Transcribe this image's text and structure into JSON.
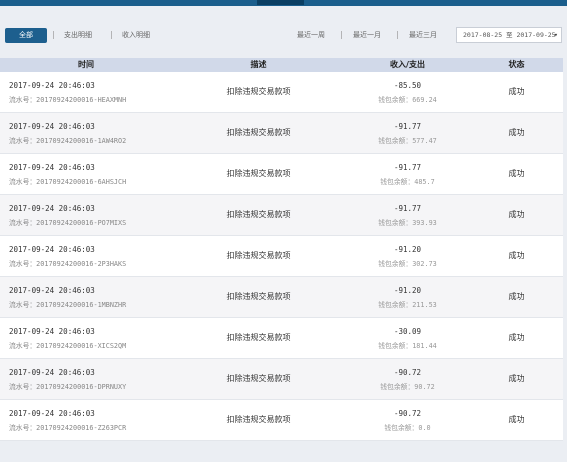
{
  "filters": {
    "all": "全部",
    "expense": "支出明细",
    "income": "收入明细",
    "separator": "|",
    "last_week": "最近一周",
    "last_month": "最近一月",
    "last_three_months": "最近三月",
    "date_range": "2017-08-25 至 2017-09-25"
  },
  "table": {
    "headers": {
      "time": "时间",
      "desc": "描述",
      "amount": "收入/支出",
      "status": "状态"
    },
    "rows": [
      {
        "time": "2017-09-24 20:46:03",
        "serial": "流水号：20170924200016-HEAXMNH",
        "desc": "扣除违规交易款项",
        "amount": "-85.50",
        "balance": "钱包余额：669.24",
        "status": "成功"
      },
      {
        "time": "2017-09-24 20:46:03",
        "serial": "流水号：20170924200016-1AW4RO2",
        "desc": "扣除违规交易款项",
        "amount": "-91.77",
        "balance": "钱包余额：577.47",
        "status": "成功"
      },
      {
        "time": "2017-09-24 20:46:03",
        "serial": "流水号：20170924200016-6AHSJCH",
        "desc": "扣除违规交易款项",
        "amount": "-91.77",
        "balance": "钱包余额：485.7",
        "status": "成功"
      },
      {
        "time": "2017-09-24 20:46:03",
        "serial": "流水号：20170924200016-PO7MIXS",
        "desc": "扣除违规交易款项",
        "amount": "-91.77",
        "balance": "钱包余额：393.93",
        "status": "成功"
      },
      {
        "time": "2017-09-24 20:46:03",
        "serial": "流水号：20170924200016-2P3HAKS",
        "desc": "扣除违规交易款项",
        "amount": "-91.20",
        "balance": "钱包余额：302.73",
        "status": "成功"
      },
      {
        "time": "2017-09-24 20:46:03",
        "serial": "流水号：20170924200016-1MBNZHR",
        "desc": "扣除违规交易款项",
        "amount": "-91.20",
        "balance": "钱包余额：211.53",
        "status": "成功"
      },
      {
        "time": "2017-09-24 20:46:03",
        "serial": "流水号：20170924200016-XICS2QM",
        "desc": "扣除违规交易款项",
        "amount": "-30.09",
        "balance": "钱包余额：181.44",
        "status": "成功"
      },
      {
        "time": "2017-09-24 20:46:03",
        "serial": "流水号：20170924200016-DPRNUXY",
        "desc": "扣除违规交易款项",
        "amount": "-90.72",
        "balance": "钱包余额：90.72",
        "status": "成功"
      },
      {
        "time": "2017-09-24 20:46:03",
        "serial": "流水号：20170924200016-Z263PCR",
        "desc": "扣除违规交易款项",
        "amount": "-90.72",
        "balance": "钱包余额：0.0",
        "status": "成功"
      }
    ]
  },
  "colors": {
    "accent": "#1d5f8e",
    "header_bg": "#d1d9e9",
    "page_bg": "#ebeef3"
  }
}
